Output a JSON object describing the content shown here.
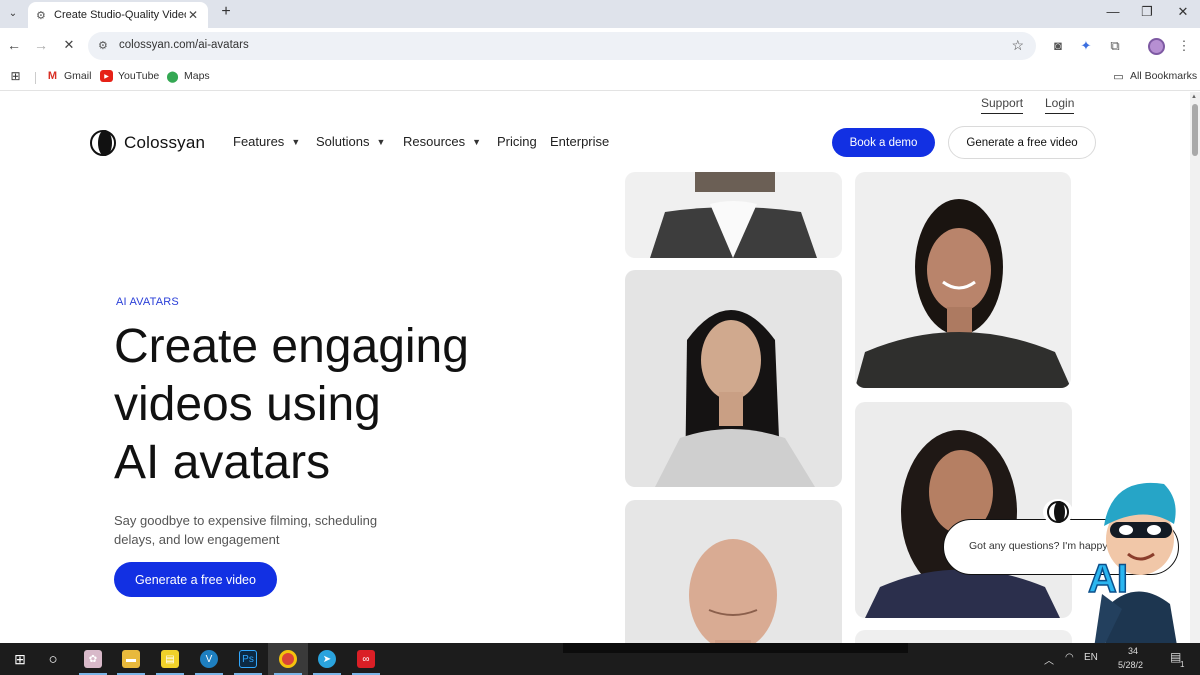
{
  "browser": {
    "tab_title": "Create Studio-Quality Videos w",
    "tab_close": "✕",
    "new_tab": "+",
    "tab_menu": "⌄",
    "url": "colossyan.com/ai-avatars",
    "window_controls": [
      "—",
      "❐",
      "✕"
    ],
    "bookmarks": [
      {
        "label": "Gmail",
        "icon": "gmail-icon"
      },
      {
        "label": "YouTube",
        "icon": "youtube-icon"
      },
      {
        "label": "Maps",
        "icon": "maps-icon"
      }
    ],
    "all_bookmarks": "All Bookmarks"
  },
  "site": {
    "top_links": {
      "support": "Support",
      "login": "Login"
    },
    "logo_text": "Colossyan",
    "nav": {
      "features": "Features",
      "solutions": "Solutions",
      "resources": "Resources",
      "pricing": "Pricing",
      "enterprise": "Enterprise"
    },
    "cta_demo": "Book a demo",
    "cta_free_top": "Generate a free video"
  },
  "hero": {
    "eyebrow": "AI AVATARS",
    "line1": "Create engaging",
    "line2": "videos using",
    "line3": "AI avatars",
    "subtitle": "Say goodbye to expensive filming, scheduling delays, and low engagement",
    "cta": "Generate a free video"
  },
  "chat": {
    "message": "Got any questions? I'm happy",
    "mascot_text": "AI"
  },
  "taskbar": {
    "tray_lang": "EN",
    "time": "34",
    "date": "5/28/2",
    "notif_count": "1"
  },
  "colors": {
    "brand_blue": "#1230e3",
    "eyebrow_blue": "#2a3fd8"
  }
}
